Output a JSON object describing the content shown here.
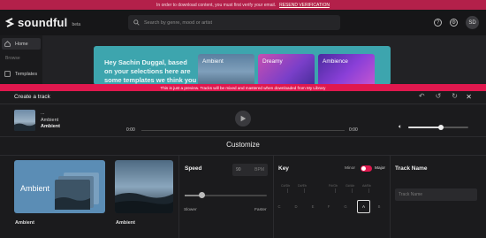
{
  "verify_banner": {
    "text": "In order to download content, you must first verify your email.",
    "link": "RESEND VERIFICATION"
  },
  "topnav": {
    "logo": "soundful",
    "beta": "beta",
    "search_placeholder": "Search by genre, mood or artist",
    "avatar_initials": "SD"
  },
  "sidebar": {
    "items": [
      {
        "label": "Home",
        "icon": "home-icon"
      },
      {
        "label": "Templates",
        "icon": "templates-icon"
      }
    ],
    "section": "Browse"
  },
  "promo": {
    "text": "Hey Sachin Duggal, based on your selections here are some templates we think you",
    "tiles": [
      "Ambient",
      "Dreamy",
      "Ambience"
    ]
  },
  "preview_banner": "This is just a preview. Tracks will be mixed and mastered when downloaded from My Library",
  "modal": {
    "title": "Create a track",
    "player": {
      "line1": "...",
      "line2": "Ambient",
      "line3": "Ambient",
      "time_start": "0:00",
      "time_end": "0:00",
      "volume": 0.55
    },
    "customize_title": "Customize",
    "styles": [
      {
        "label": "Ambient",
        "card_title": "Ambient"
      },
      {
        "label": "Ambient"
      }
    ],
    "speed": {
      "label": "Speed",
      "bpm": "90",
      "unit": "BPM",
      "slow": "Slower",
      "fast": "Faster",
      "value": 0.2
    },
    "key": {
      "label": "Key",
      "minor": "Minor",
      "major": "Major",
      "sharps": [
        "C#/Db",
        "D#/Eb",
        "F#/Gb",
        "G#/Ab",
        "A#/Bb"
      ],
      "notes": [
        "C",
        "D",
        "E",
        "F",
        "G",
        "A",
        "B"
      ],
      "selected": "A"
    },
    "track_name": {
      "label": "Track Name",
      "placeholder": "Track Name"
    }
  },
  "colors": {
    "accent": "#e0184e",
    "verify_bg": "#b3204a",
    "promo_bg": "#3da5ae"
  }
}
